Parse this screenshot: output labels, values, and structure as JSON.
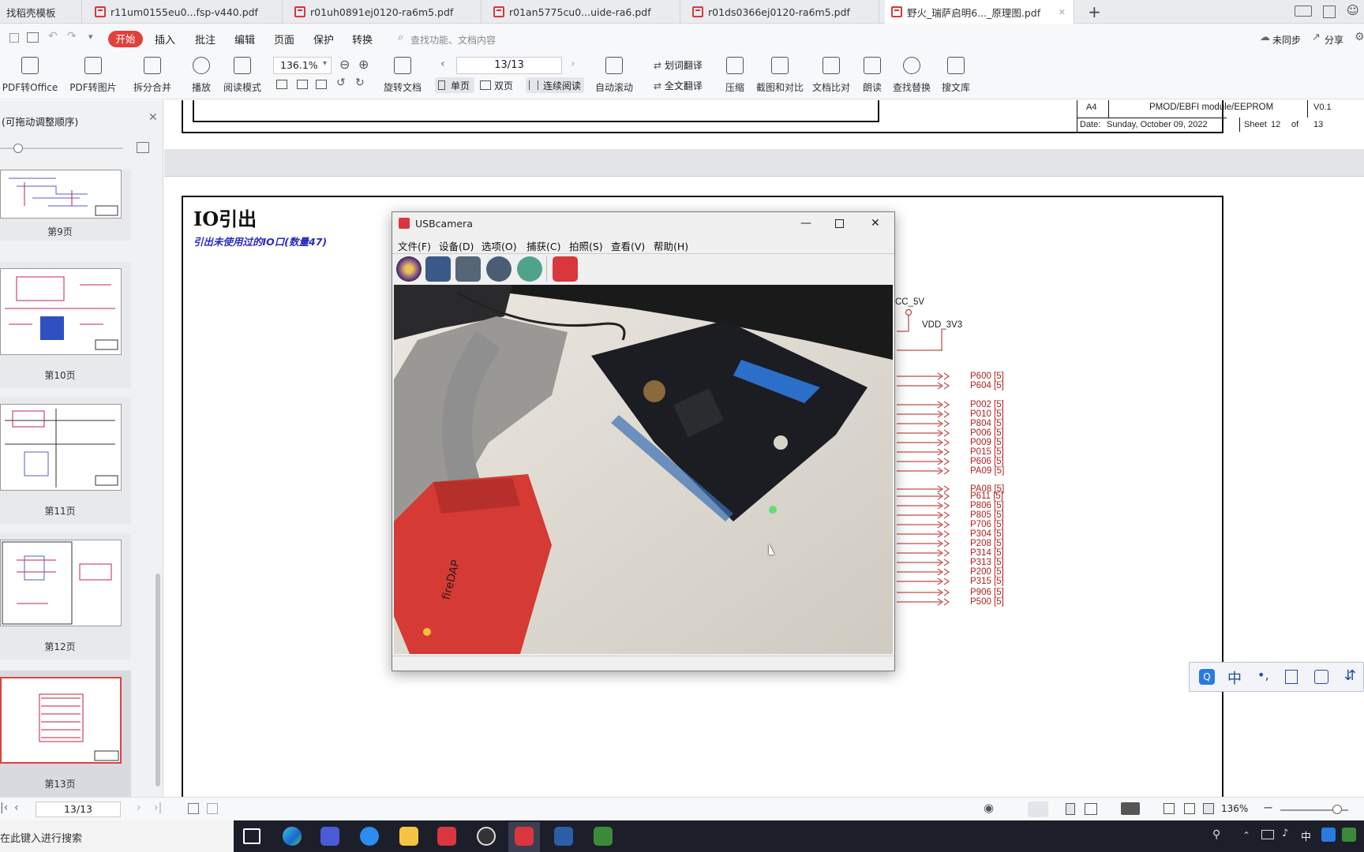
{
  "tabs": [
    {
      "label": "找稻壳模板"
    },
    {
      "label": "r11um0155eu0...fsp-v440.pdf"
    },
    {
      "label": "r01uh0891ej0120-ra6m5.pdf"
    },
    {
      "label": "r01an5775cu0...uide-ra6.pdf"
    },
    {
      "label": "r01ds0366ej0120-ra6m5.pdf"
    },
    {
      "label": "野火_瑞萨启明6..._原理图.pdf"
    }
  ],
  "menu": {
    "start": "开始",
    "items": [
      "插入",
      "批注",
      "编辑",
      "页面",
      "保护",
      "转换"
    ],
    "search_placeholder": "查找功能、文档内容",
    "sync": "未同步",
    "share": "分享"
  },
  "toolbar": {
    "pdf_office": "PDF转Office",
    "pdf_image": "PDF转图片",
    "split_merge": "拆分合并",
    "play": "播放",
    "read_mode": "阅读模式",
    "zoom": "136.1%",
    "rotate": "旋转文档",
    "page": "13/13",
    "single": "单页",
    "double": "双页",
    "continuous": "连续阅读",
    "auto_scroll": "自动滚动",
    "word_translate": "划词翻译",
    "full_translate": "全文翻译",
    "compress": "压缩",
    "screenshot_compare": "截图和对比",
    "doc_compare": "文档比对",
    "read_aloud": "朗读",
    "find_replace": "查找替换",
    "search_lib": "搜文库"
  },
  "sidebar": {
    "title": "(可拖动调整顺序)",
    "pages": [
      "第9页",
      "第10页",
      "第11页",
      "第12页",
      "第13页"
    ],
    "current_page": "13/13"
  },
  "titleblock": {
    "size": "A4",
    "title": "PMOD/EBFI module/EEPROM",
    "rev": "V0.1",
    "date_label": "Date:",
    "date": "Sunday, October 09, 2022",
    "sheet_label": "Sheet",
    "sheet": "12",
    "of_label": "of",
    "of": "13"
  },
  "schematic": {
    "heading": "IO引出",
    "subheading": "引出未使用过的IO口(数量47)",
    "power": [
      "CC_5V",
      "VDD_3V3"
    ],
    "nets": [
      "P600 [5]",
      "P604 [5]",
      "P002 [5]",
      "P010 [5]",
      "P804 [5]",
      "P006 [5]",
      "P009 [5]",
      "P015 [5]",
      "P606 [5]",
      "PA09 [5]",
      "PA08 [5]",
      "P611 [5]",
      "P806 [5]",
      "P805 [5]",
      "P706 [5]",
      "P304 [5]",
      "P208 [5]",
      "P314 [5]",
      "P313 [5]",
      "P200 [5]",
      "P315 [5]",
      "P906 [5]",
      "P500 [5]"
    ]
  },
  "camera": {
    "title": "USBcamera",
    "menu": [
      "文件(F)",
      "设备(D)",
      "选项(O)",
      "捕获(C)",
      "拍照(S)",
      "查看(V)",
      "帮助(H)"
    ]
  },
  "status": {
    "page": "13/13",
    "zoom": "136%"
  },
  "taskbar": {
    "search_placeholder": "在此键入进行搜索",
    "ime": "中"
  }
}
